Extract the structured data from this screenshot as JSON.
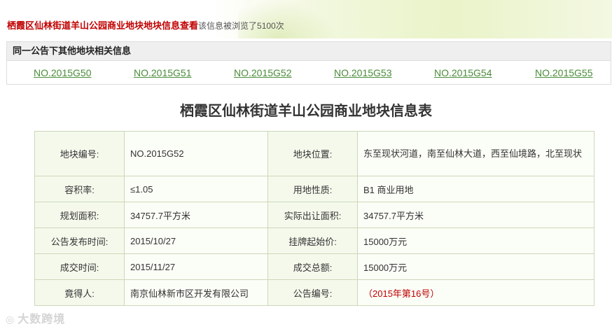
{
  "header": {
    "title": "栖霞区仙林街道羊山公园商业地块地块信息查看",
    "views_text": "该信息被浏览了5100次"
  },
  "related": {
    "heading": "同一公告下其他地块相关信息",
    "links": [
      "NO.2015G50",
      "NO.2015G51",
      "NO.2015G52",
      "NO.2015G53",
      "NO.2015G54",
      "NO.2015G55"
    ]
  },
  "table": {
    "title": "栖霞区仙林街道羊山公园商业地块信息表",
    "rows": [
      [
        {
          "label": "地块编号:",
          "value": "NO.2015G52"
        },
        {
          "label": "地块位置:",
          "value": "东至现状河道，南至仙林大道，西至仙境路，北至现状"
        }
      ],
      [
        {
          "label": "容积率:",
          "value": "≤1.05"
        },
        {
          "label": "用地性质:",
          "value": "B1 商业用地"
        }
      ],
      [
        {
          "label": "规划面积:",
          "value": "34757.7平方米"
        },
        {
          "label": "实际出让面积:",
          "value": "34757.7平方米"
        }
      ],
      [
        {
          "label": "公告发布时间:",
          "value": "2015/10/27"
        },
        {
          "label": "挂牌起始价:",
          "value": "15000万元"
        }
      ],
      [
        {
          "label": "成交时间:",
          "value": "2015/11/27"
        },
        {
          "label": "成交总额:",
          "value": "15000万元"
        }
      ],
      [
        {
          "label": "竟得人:",
          "value": "南京仙林新市区开发有限公司"
        },
        {
          "label": "公告编号:",
          "value": "（2015年第16号）"
        }
      ]
    ]
  },
  "watermark": "大数跨境",
  "colors": {
    "title_red": "#c00000",
    "link_green": "#4a8c3a",
    "cell_border": "#ccd8b8"
  }
}
